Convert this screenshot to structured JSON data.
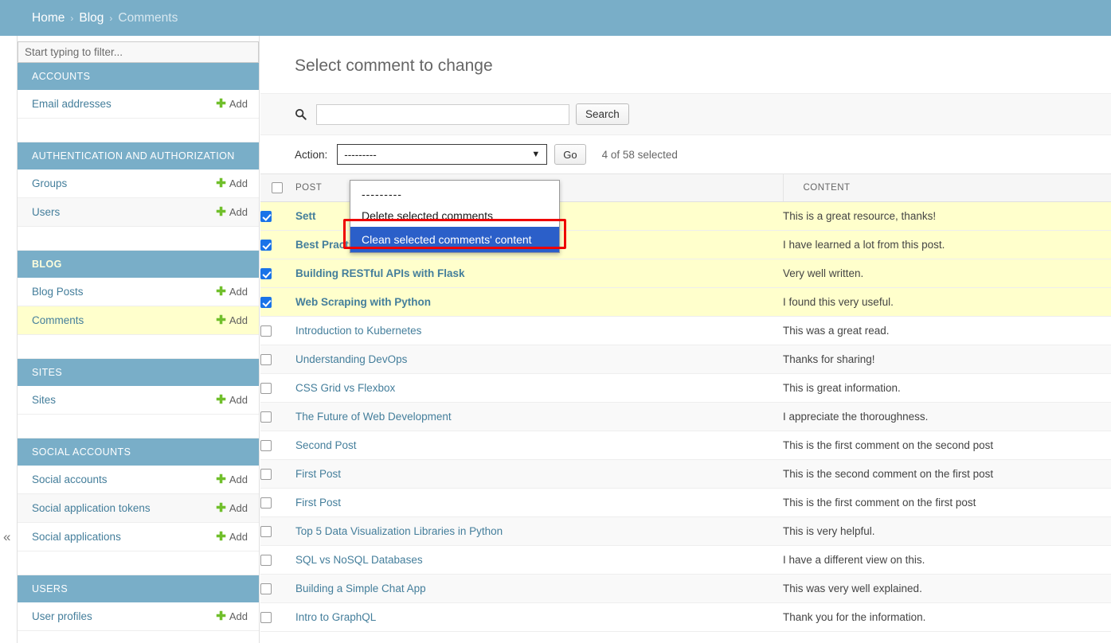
{
  "breadcrumb": {
    "items": [
      {
        "label": "Home",
        "current": false
      },
      {
        "label": "Blog",
        "current": false
      },
      {
        "label": "Comments",
        "current": true
      }
    ],
    "separator": "›"
  },
  "sidebar": {
    "filter_placeholder": "Start typing to filter...",
    "filter_value": "",
    "collapse_icon": "«",
    "add_label": "Add",
    "groups": [
      {
        "title": "ACCOUNTS",
        "active": false,
        "models": [
          {
            "label": "Email addresses",
            "current": false
          }
        ]
      },
      {
        "title": "AUTHENTICATION AND AUTHORIZATION",
        "active": false,
        "models": [
          {
            "label": "Groups",
            "current": false
          },
          {
            "label": "Users",
            "current": false
          }
        ]
      },
      {
        "title": "BLOG",
        "active": true,
        "models": [
          {
            "label": "Blog Posts",
            "current": false
          },
          {
            "label": "Comments",
            "current": true
          }
        ]
      },
      {
        "title": "SITES",
        "active": false,
        "models": [
          {
            "label": "Sites",
            "current": false
          }
        ]
      },
      {
        "title": "SOCIAL ACCOUNTS",
        "active": false,
        "models": [
          {
            "label": "Social accounts",
            "current": false
          },
          {
            "label": "Social application tokens",
            "current": false
          },
          {
            "label": "Social applications",
            "current": false
          }
        ]
      },
      {
        "title": "USERS",
        "active": false,
        "models": [
          {
            "label": "User profiles",
            "current": false
          }
        ]
      }
    ]
  },
  "main": {
    "page_title": "Select comment to change",
    "search": {
      "value": "",
      "placeholder": "",
      "button_label": "Search",
      "icon": "search-icon"
    },
    "actions": {
      "label": "Action:",
      "selected_value": "---------",
      "go_label": "Go",
      "counter": "4 of 58 selected",
      "dropdown_open": true,
      "options": [
        {
          "label": "---------",
          "highlighted": false
        },
        {
          "label": "Delete selected comments",
          "highlighted": false
        },
        {
          "label": "Clean selected comments' content",
          "highlighted": true
        }
      ]
    },
    "table": {
      "columns": [
        "",
        "POST",
        "CONTENT"
      ],
      "rows": [
        {
          "checked": true,
          "post": "Sett",
          "content": "This is a great resource, thanks!"
        },
        {
          "checked": true,
          "post": "Best Practices for Code Reviews",
          "content": "I have learned a lot from this post."
        },
        {
          "checked": true,
          "post": "Building RESTful APIs with Flask",
          "content": "Very well written."
        },
        {
          "checked": true,
          "post": "Web Scraping with Python",
          "content": "I found this very useful."
        },
        {
          "checked": false,
          "post": "Introduction to Kubernetes",
          "content": "This was a great read."
        },
        {
          "checked": false,
          "post": "Understanding DevOps",
          "content": "Thanks for sharing!"
        },
        {
          "checked": false,
          "post": "CSS Grid vs Flexbox",
          "content": "This is great information."
        },
        {
          "checked": false,
          "post": "The Future of Web Development",
          "content": "I appreciate the thoroughness."
        },
        {
          "checked": false,
          "post": "Second Post",
          "content": "This is the first comment on the second post"
        },
        {
          "checked": false,
          "post": "First Post",
          "content": "This is the second comment on the first post"
        },
        {
          "checked": false,
          "post": "First Post",
          "content": "This is the first comment on the first post"
        },
        {
          "checked": false,
          "post": "Top 5 Data Visualization Libraries in Python",
          "content": "This is very helpful."
        },
        {
          "checked": false,
          "post": "SQL vs NoSQL Databases",
          "content": "I have a different view on this."
        },
        {
          "checked": false,
          "post": "Building a Simple Chat App",
          "content": "This was very well explained."
        },
        {
          "checked": false,
          "post": "Intro to GraphQL",
          "content": "Thank you for the information."
        }
      ]
    }
  },
  "colors": {
    "header_blue": "#79aec8",
    "link_blue": "#447e9b",
    "selected_row_yellow": "#ffffcc",
    "dropdown_highlight": "#2b5fc9",
    "annotation_red": "#ee0000",
    "add_green": "#70bf2b"
  }
}
